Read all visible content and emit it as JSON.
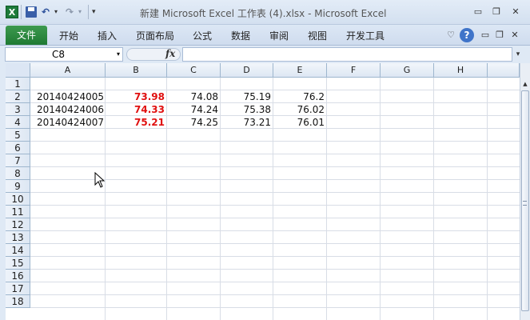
{
  "titlebar": {
    "app_icon_letter": "X",
    "title": "新建 Microsoft Excel 工作表 (4).xlsx  -  Microsoft Excel",
    "undo_glyph": "↶",
    "redo_glyph": "↷",
    "dropdown_glyph": "▾",
    "customize_glyph": "▾",
    "minimize_glyph": "▭",
    "restore_glyph": "❐",
    "close_glyph": "✕"
  },
  "ribbon": {
    "file_tab": "文件",
    "tabs": [
      "开始",
      "插入",
      "页面布局",
      "公式",
      "数据",
      "审阅",
      "视图",
      "开发工具"
    ],
    "collapse_glyph": "♡",
    "help_glyph": "?",
    "min_glyph": "▭",
    "restore_glyph": "❐",
    "close_glyph": "✕"
  },
  "formula_bar": {
    "name_box": "C8",
    "name_box_arrow": "▾",
    "fx_label": "fx",
    "formula_value": "",
    "expand_glyph": "▾"
  },
  "sheet": {
    "columns": [
      "A",
      "B",
      "C",
      "D",
      "E",
      "F",
      "G",
      "H"
    ],
    "rows": [
      "1",
      "2",
      "3",
      "4",
      "5",
      "6",
      "7",
      "8",
      "9",
      "10",
      "11",
      "12",
      "13",
      "14",
      "15",
      "16",
      "17",
      "18"
    ],
    "data": [
      [
        "20140424005",
        "73.98",
        "74.08",
        "75.19",
        "76.2"
      ],
      [
        "20140424006",
        "74.33",
        "74.24",
        "75.38",
        "76.02"
      ],
      [
        "20140424007",
        "75.21",
        "74.25",
        "73.21",
        "76.01"
      ]
    ],
    "highlight_color": "#e01010"
  },
  "icons": {
    "app": "excel-icon",
    "save": "save-icon",
    "undo": "undo-icon",
    "redo": "redo-icon",
    "help": "help-icon",
    "cursor": "mouse-cursor-icon"
  }
}
